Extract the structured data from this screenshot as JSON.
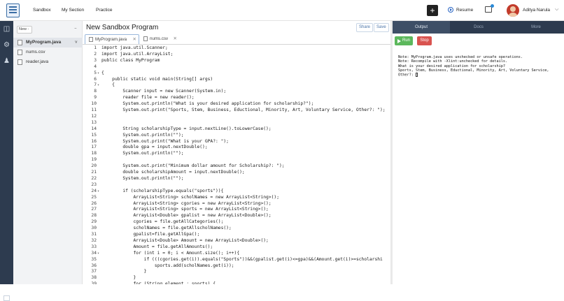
{
  "header": {
    "nav": [
      "Sandbox",
      "My Section",
      "Practice"
    ],
    "add_label": "+",
    "resume_label": "Resume",
    "user_name": "Aditya Narula"
  },
  "sidebar": {
    "new_label": "New -",
    "menu_label": "...",
    "files": [
      "MyProgram.java",
      "nums.csv",
      "reader.java"
    ]
  },
  "editor": {
    "title": "New Sandbox Program",
    "share_label": "Share",
    "save_label": "Save",
    "tabs": [
      "MyProgram.java",
      "nums.csv"
    ],
    "lines": [
      {
        "n": "1",
        "t": "import java.util.Scanner;"
      },
      {
        "n": "2",
        "t": "import java.util.ArrayList;"
      },
      {
        "n": "3",
        "t": "public class MyProgram"
      },
      {
        "n": "4",
        "t": ""
      },
      {
        "n": "5",
        "t": "{"
      },
      {
        "n": "6",
        "t": "    public static void main(String[] args)"
      },
      {
        "n": "7",
        "t": "    {"
      },
      {
        "n": "8",
        "t": "        Scanner input = new Scanner(System.in);"
      },
      {
        "n": "9",
        "t": "        reader file = new reader();"
      },
      {
        "n": "10",
        "t": "        System.out.println(\"What is your desired application for scholarship?\");"
      },
      {
        "n": "11",
        "t": "        System.out.print(\"Sports, Stem, Business, Eductional, Minority, Art, Voluntary Service, Other?: \");"
      },
      {
        "n": "12",
        "t": ""
      },
      {
        "n": "13",
        "t": ""
      },
      {
        "n": "14",
        "t": "        String scholarshipType = input.nextLine().toLowerCase();"
      },
      {
        "n": "15",
        "t": "        System.out.println(\"\");"
      },
      {
        "n": "16",
        "t": "        System.out.print(\"What is your GPA?: \");"
      },
      {
        "n": "17",
        "t": "        double gpa = input.nextDouble();"
      },
      {
        "n": "18",
        "t": "        System.out.println(\"\");"
      },
      {
        "n": "19",
        "t": ""
      },
      {
        "n": "20",
        "t": "        System.out.print(\"Minimum dollar amount for Scholarship?: \");"
      },
      {
        "n": "21",
        "t": "        double scholarshipAmount = input.nextDouble();"
      },
      {
        "n": "22",
        "t": "        System.out.println(\"\");"
      },
      {
        "n": "23",
        "t": ""
      },
      {
        "n": "24",
        "t": "        if (scholarshipType.equals(\"sports\")){"
      },
      {
        "n": "25",
        "t": "            ArrayList<String> scholNames = new ArrayList<String>();"
      },
      {
        "n": "26",
        "t": "            ArrayList<String> cgories = new ArrayList<String>();"
      },
      {
        "n": "27",
        "t": "            ArrayList<String> sports = new ArrayList<String>();"
      },
      {
        "n": "28",
        "t": "            ArrayList<Double> gpalist = new ArrayList<Double>();"
      },
      {
        "n": "29",
        "t": "            cgories = file.getAllCategories();"
      },
      {
        "n": "30",
        "t": "            scholNames = file.getAllscholNames();"
      },
      {
        "n": "31",
        "t": "            gpalist=file.getAllGpa();"
      },
      {
        "n": "32",
        "t": "            ArrayList<Double> Amount = new ArrayList<Double>();"
      },
      {
        "n": "33",
        "t": "            Amount = file.getAllAmounts();"
      },
      {
        "n": "34",
        "t": "            for (int i = 0; i < Amount.size(); i++){"
      },
      {
        "n": "35",
        "t": "                if (((cgories.get(i)).equals(\"Sports\"))&&(gpalist.get(i)<=gpa)&&(Amount.get(i)>=scholarshi"
      },
      {
        "n": "36",
        "t": "                    sports.add(scholNames.get(i));"
      },
      {
        "n": "37",
        "t": "                }"
      },
      {
        "n": "38",
        "t": "            }"
      },
      {
        "n": "39",
        "t": "            for (String element : sports) {"
      }
    ]
  },
  "output": {
    "tabs": [
      "Output",
      "Docs",
      "More"
    ],
    "run_label": "Run",
    "stop_label": "Stop",
    "console_text": "Note: MyProgram.java uses unchecked or unsafe operations.\nNote: Recompile with -Xlint:unchecked for details.\nWhat is your desired application for scholarship?\nSports, Stem, Business, Eductional, Minority, Art, Voluntary Service,\nOther?: "
  },
  "colors": {
    "rail": "#2d3b4f",
    "run_green": "#5cb85c",
    "stop_red": "#d9534f",
    "accent_blue": "#4a74a8"
  }
}
